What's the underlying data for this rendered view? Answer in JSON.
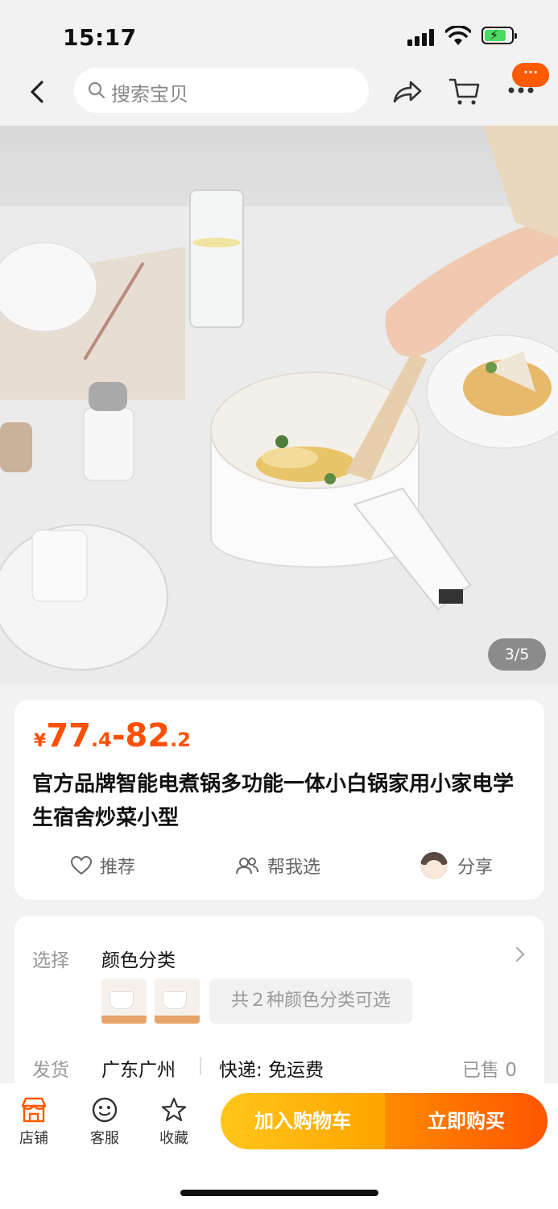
{
  "status_bar": {
    "time": "15:17"
  },
  "nav": {
    "search_placeholder": "搜索宝贝",
    "more_badge": "···"
  },
  "gallery": {
    "counter": "3/5",
    "image_description_icon": "product-photo"
  },
  "product": {
    "price_currency": "¥",
    "price_low_int": "77",
    "price_low_dec": ".4",
    "price_sep": "-",
    "price_high_int": "82",
    "price_high_dec": ".2",
    "title": "官方品牌智能电煮锅多功能一体小白锅家用小家电学生宿舍炒菜小型",
    "actions": {
      "recommend": "推荐",
      "help_choose": "帮我选",
      "share": "分享"
    }
  },
  "options": {
    "select_label": "选择",
    "select_value": "颜色分类",
    "variants_chip": "共２种颜色分类可选",
    "ship_label": "发货",
    "ship_from": "广东广州",
    "delivery": "快递: 免运费",
    "sold": "已售 0"
  },
  "bottom_bar": {
    "shop": "店铺",
    "service": "客服",
    "favorite": "收藏",
    "add_to_cart": "加入购物车",
    "buy_now": "立即购买"
  },
  "colors": {
    "accent": "#ff4f00",
    "cart_button": "#ffb300",
    "buy_button": "#ff6a00"
  }
}
